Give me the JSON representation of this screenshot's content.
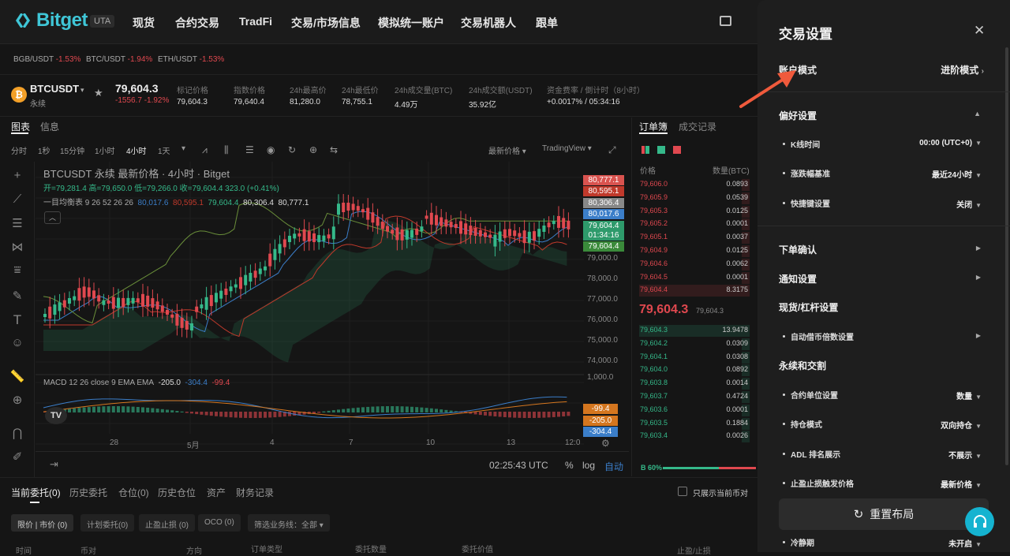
{
  "nav": {
    "brand": "Bitget",
    "badge": "UTA",
    "items": [
      "现货",
      "合约交易",
      "TradFi",
      "交易/市场信息",
      "模拟统一账户",
      "交易机器人",
      "跟单"
    ]
  },
  "tickers": [
    {
      "pair": "BGB/USDT",
      "change": "-1.53%"
    },
    {
      "pair": "BTC/USDT",
      "change": "-1.94%"
    },
    {
      "pair": "ETH/USDT",
      "change": "-1.53%"
    }
  ],
  "symbol": {
    "name": "BTCUSDT",
    "type": "永续",
    "price": "79,604.3",
    "change": "-1556.7 -1.92%",
    "stats": [
      {
        "label": "标记价格",
        "value": "79,604.3"
      },
      {
        "label": "指数价格",
        "value": "79,640.4"
      },
      {
        "label": "24h最高价",
        "value": "81,280.0"
      },
      {
        "label": "24h最低价",
        "value": "78,755.1"
      },
      {
        "label": "24h成交量(BTC)",
        "value": "4.49万"
      },
      {
        "label": "24h成交额(USDT)",
        "value": "35.92亿"
      },
      {
        "label": "资金费率 / 倒计时（8小时）",
        "value": "+0.0017% / 05:34:16"
      }
    ]
  },
  "chart_tabs": [
    "图表",
    "信息"
  ],
  "intervals": [
    "分时",
    "1秒",
    "15分钟",
    "1小时",
    "4小时",
    "1天"
  ],
  "price_source": "最新价格",
  "tradingview": "TradingView",
  "chart_header": {
    "title": "BTCUSDT 永续 最新价格 · 4小时 · Bitget",
    "ohlc": "开=79,281.4  高=79,650.0  低=79,266.0  收=79,604.4  323.0 (+0.41%)",
    "ichimoku_label": "一目均衡表 9 26 52 26 26",
    "ichimoku_values": [
      "80,017.6",
      "80,595.1",
      "79,604.4",
      "80,306.4",
      "80,777.1"
    ],
    "macd_label": "MACD 12 26 close 9 EMA EMA",
    "macd_values": [
      "-205.0",
      "-304.4",
      "-99.4"
    ]
  },
  "price_axis": [
    "79,000.0",
    "78,000.0",
    "77,000.0",
    "76,000.0",
    "75,000.0",
    "74,000.0",
    "1,000.0"
  ],
  "price_tags": [
    {
      "v": "80,777.1",
      "c": "#d9534f"
    },
    {
      "v": "80,595.1",
      "c": "#c0392b"
    },
    {
      "v": "80,306.4",
      "c": "#888888"
    },
    {
      "v": "80,017.6",
      "c": "#3b7ec9"
    },
    {
      "v": "79,604.4",
      "c": "#2e9a6b"
    },
    {
      "v": "01:34:16",
      "c": "#2e9a6b"
    },
    {
      "v": "79,604.4",
      "c": "#3a8a3a"
    }
  ],
  "macd_tags": [
    {
      "v": "-99.4",
      "c": "#d4761f"
    },
    {
      "v": "-205.0",
      "c": "#d4761f"
    },
    {
      "v": "-304.4",
      "c": "#3b7ec9"
    }
  ],
  "x_axis": [
    "28",
    "5月",
    "4",
    "7",
    "10",
    "13",
    "12:0"
  ],
  "chart_footer": {
    "time": "02:25:43 UTC",
    "pct": "%",
    "log": "log",
    "auto": "自动"
  },
  "orderbook": {
    "tabs": [
      "订单簿",
      "成交记录"
    ],
    "col_price": "价格",
    "col_qty": "数量(BTC)",
    "asks": [
      {
        "p": "79,606.0",
        "q": "0.0893"
      },
      {
        "p": "79,605.9",
        "q": "0.0539"
      },
      {
        "p": "79,605.3",
        "q": "0.0125"
      },
      {
        "p": "79,605.2",
        "q": "0.0001"
      },
      {
        "p": "79,605.1",
        "q": "0.0037"
      },
      {
        "p": "79,604.9",
        "q": "0.0125"
      },
      {
        "p": "79,604.6",
        "q": "0.0062"
      },
      {
        "p": "79,604.5",
        "q": "0.0001"
      },
      {
        "p": "79,604.4",
        "q": "8.3175"
      }
    ],
    "last": "79,604.3",
    "mark": "79,604.3",
    "bids": [
      {
        "p": "79,604.3",
        "q": "13.9478"
      },
      {
        "p": "79,604.2",
        "q": "0.0309"
      },
      {
        "p": "79,604.1",
        "q": "0.0308"
      },
      {
        "p": "79,604.0",
        "q": "0.0892"
      },
      {
        "p": "79,603.8",
        "q": "0.0014"
      },
      {
        "p": "79,603.7",
        "q": "0.4724"
      },
      {
        "p": "79,603.6",
        "q": "0.0001"
      },
      {
        "p": "79,603.5",
        "q": "0.1884"
      },
      {
        "p": "79,603.4",
        "q": "0.0026"
      }
    ],
    "ratio": "B 60%"
  },
  "bottom": {
    "tabs": [
      "当前委托(0)",
      "历史委托",
      "仓位(0)",
      "历史仓位",
      "资产",
      "财务记录"
    ],
    "only_show": "只展示当前币对",
    "chips": [
      "限价 | 市价 (0)",
      "计划委托(0)",
      "止盈止损 (0)",
      "OCO (0)",
      "筛选业务线：全部"
    ],
    "cols": [
      "时间",
      "币对",
      "方向",
      "订单类型",
      "委托数量",
      "委托价值",
      "止盈/止损"
    ]
  },
  "panel": {
    "title": "交易设置",
    "account_mode_label": "账户模式",
    "account_mode_value": "进阶模式",
    "pref": "偏好设置",
    "kline_time": "K线时间",
    "kline_time_value": "00:00 (UTC+0)",
    "change_base": "涨跌幅基准",
    "change_base_value": "最近24小时",
    "shortcut": "快捷键设置",
    "shortcut_value": "关闭",
    "order_confirm": "下单确认",
    "notify": "通知设置",
    "spot_margin": "现货/杠杆设置",
    "auto_borrow": "自动借币倍数设置",
    "perp_delivery": "永续和交割",
    "contract_unit": "合约单位设置",
    "contract_unit_value": "数量",
    "position_mode": "持仓模式",
    "position_mode_value": "双向持仓",
    "adl": "ADL 排名展示",
    "adl_value": "不展示",
    "tpsl_trigger": "止盈止损触发价格",
    "tpsl_trigger_value": "最新价格",
    "reset": "重置布局",
    "cooldown": "冷静期",
    "cooldown_value": "未开启"
  },
  "colors": {
    "brand": "#3fc6d7",
    "up": "#35b98a",
    "down": "#e0484f",
    "accent": "#f05a3c"
  }
}
